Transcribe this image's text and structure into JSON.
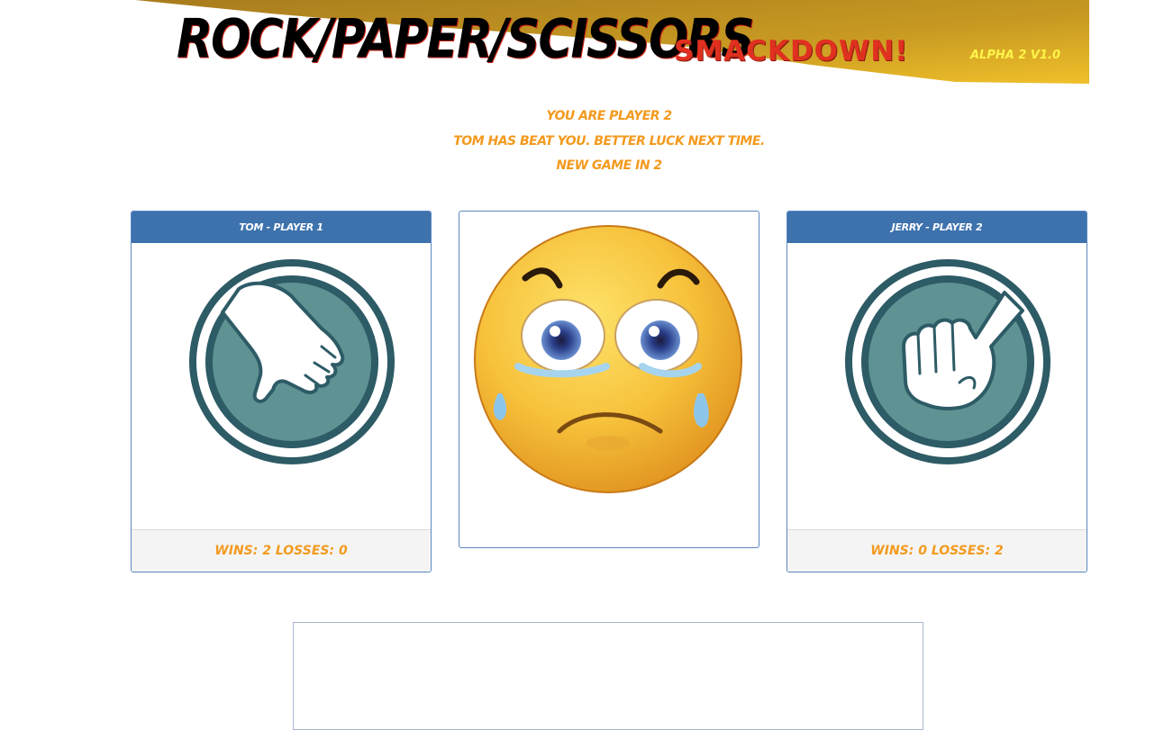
{
  "header": {
    "title": "ROCK/PAPER/SCISSORS",
    "subtitle": "SMACKDOWN!",
    "version": "ALPHA 2 V1.0"
  },
  "status": {
    "player_line": "YOU ARE PLAYER 2",
    "result_line": "TOM HAS BEAT YOU. BETTER LUCK NEXT TIME.",
    "countdown_line": "NEW GAME IN 2"
  },
  "player1": {
    "heading": "TOM - PLAYER 1",
    "choice_icon": "paper-hand-icon",
    "record": "WINS: 2 LOSSES: 0"
  },
  "player2": {
    "heading": "JERRY - PLAYER 2",
    "choice_icon": "rock-fist-icon",
    "record": "WINS: 0 LOSSES: 2"
  },
  "result": {
    "icon": "crying-face-icon"
  },
  "colors": {
    "accent_orange": "#f39a1e",
    "panel_header": "#3d72ad",
    "title_red": "#e03020",
    "icon_teal": "#5f9393",
    "icon_dark": "#2d5b66"
  }
}
